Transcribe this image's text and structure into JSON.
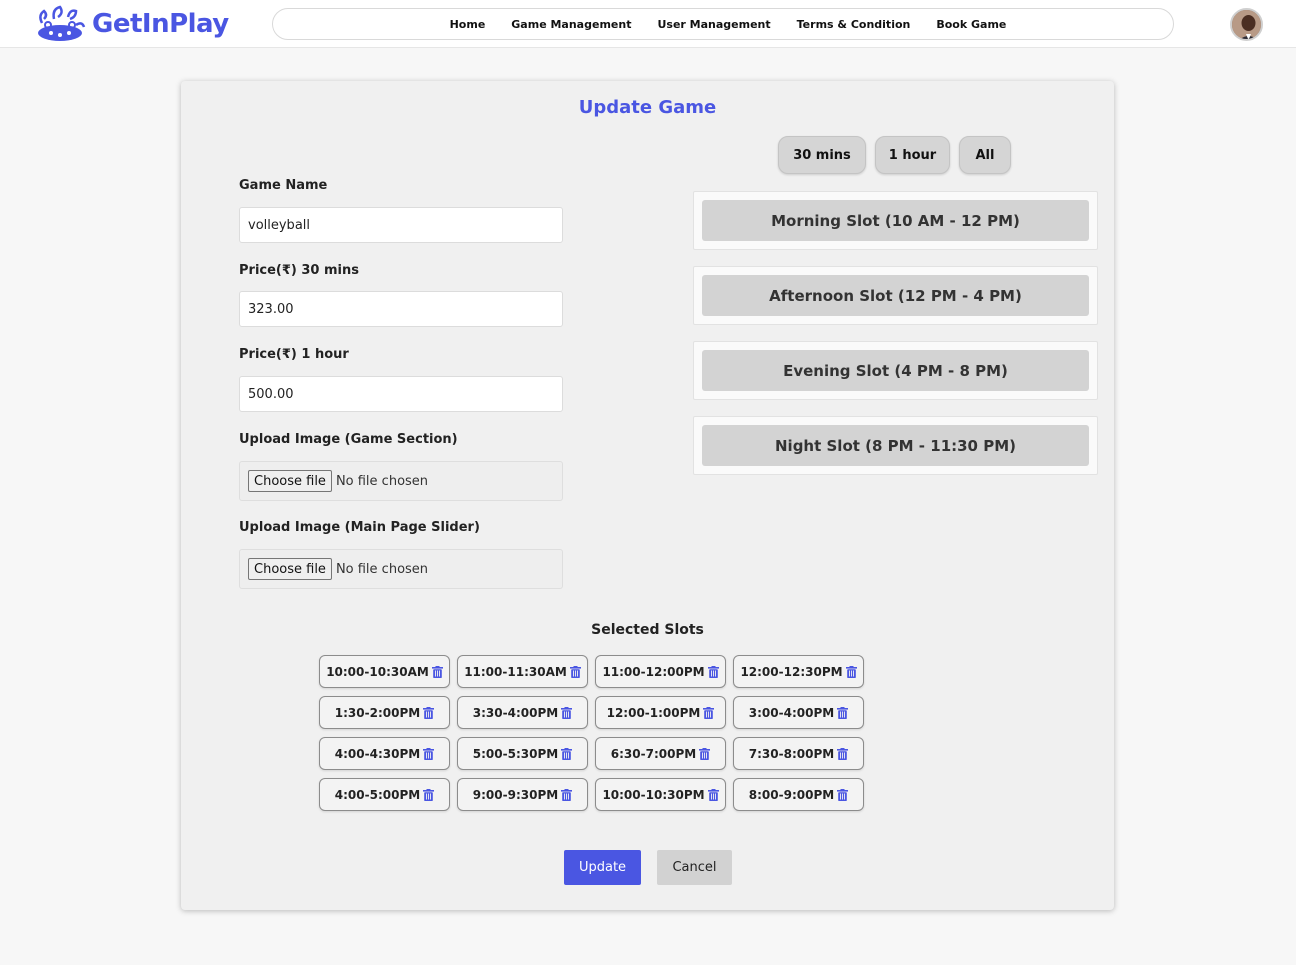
{
  "brand": {
    "name": "GetInPlay"
  },
  "nav": {
    "home": "Home",
    "game_management": "Game Management",
    "user_management": "User Management",
    "terms": "Terms & Condition",
    "book_game": "Book Game"
  },
  "form": {
    "title": "Update Game",
    "game_name_label": "Game Name",
    "game_name_value": "volleyball",
    "price30_label": "Price(₹) 30 mins",
    "price30_value": "323.00",
    "price60_label": "Price(₹) 1 hour",
    "price60_value": "500.00",
    "upload_game_label": "Upload Image (Game Section)",
    "upload_slider_label": "Upload Image (Main Page Slider)",
    "choose_file": "Choose file",
    "no_file": "No file chosen"
  },
  "durations": [
    "30 mins",
    "1 hour",
    "All"
  ],
  "slot_groups": [
    "Morning Slot (10 AM - 12 PM)",
    "Afternoon Slot (12 PM - 4 PM)",
    "Evening Slot (4 PM - 8 PM)",
    "Night Slot (8 PM - 11:30 PM)"
  ],
  "selected": {
    "title": "Selected Slots",
    "slots": [
      "10:00-10:30AM",
      "11:00-11:30AM",
      "11:00-12:00PM",
      "12:00-12:30PM",
      "1:30-2:00PM",
      "3:30-4:00PM",
      "12:00-1:00PM",
      "3:00-4:00PM",
      "4:00-4:30PM",
      "5:00-5:30PM",
      "6:30-7:00PM",
      "7:30-8:00PM",
      "4:00-5:00PM",
      "9:00-9:30PM",
      "10:00-10:30PM",
      "8:00-9:00PM"
    ]
  },
  "actions": {
    "update": "Update",
    "cancel": "Cancel"
  },
  "colors": {
    "accent": "#4a56e2",
    "slot_bg": "#d3d3d3",
    "card_bg": "#f0f0f0"
  }
}
